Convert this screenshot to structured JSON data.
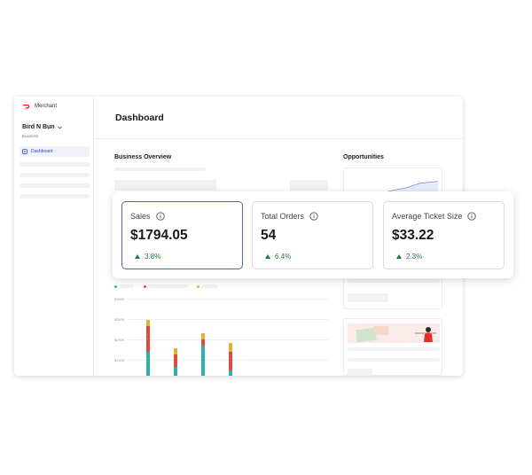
{
  "app": {
    "brand": "Merchant"
  },
  "sidebar": {
    "store_name": "Bird N Bun",
    "store_type": "Business",
    "nav": [
      {
        "label": "Dashboard"
      }
    ]
  },
  "header": {
    "title": "Dashboard"
  },
  "sections": {
    "business_overview": "Business Overview",
    "opportunities": "Opportunities"
  },
  "chart": {
    "y_ticks": [
      "$300K",
      "$250K",
      "$200K",
      "$150K"
    ],
    "legend_colors": [
      "#2bb3a9",
      "#e04b3c",
      "#e0b22f"
    ]
  },
  "metrics": [
    {
      "label": "Sales",
      "value": "$1794.05",
      "change": "3.8%",
      "selected": true
    },
    {
      "label": "Total Orders",
      "value": "54",
      "change": "6.4%",
      "selected": false
    },
    {
      "label": "Average Ticket Size",
      "value": "$33.22",
      "change": "2.3%",
      "selected": false
    }
  ],
  "colors": {
    "accent": "#4a64c4",
    "positive": "#1f7a36",
    "brand": "#eb1700"
  }
}
